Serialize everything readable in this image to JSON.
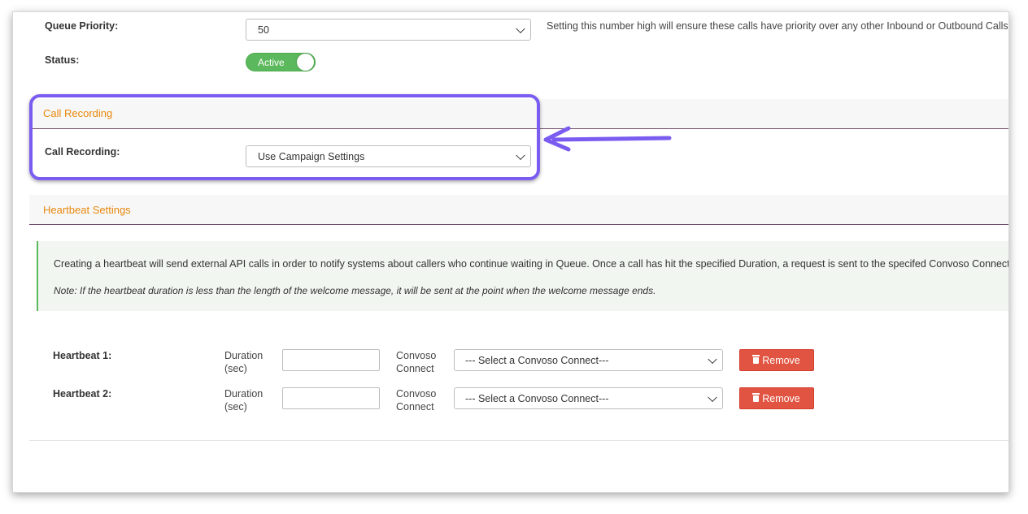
{
  "queue": {
    "priority_label": "Queue Priority:",
    "priority_value": "50",
    "priority_help": "Setting this number high will ensure these calls have priority over any other Inbound or Outbound Calls",
    "status_label": "Status:",
    "status_value": "Active"
  },
  "call_recording": {
    "section_title": "Call Recording",
    "label": "Call Recording:",
    "value": "Use Campaign Settings"
  },
  "heartbeat": {
    "section_title": "Heartbeat Settings",
    "info_text": "Creating a heartbeat will send external API calls in order to notify systems about callers who continue waiting in Queue. Once a call has hit the specified Duration, a request is sent to the specifed Convoso Connect.",
    "note_text": "Note: If the heartbeat duration is less than the length of the welcome message, it will be sent at the point when the welcome message ends.",
    "rows": [
      {
        "label": "Heartbeat 1:",
        "duration_label_1": "Duration",
        "duration_label_2": "(sec)",
        "duration_value": "",
        "connect_label_1": "Convoso",
        "connect_label_2": "Connect",
        "connect_value": "--- Select a Convoso Connect---",
        "remove_label": "Remove"
      },
      {
        "label": "Heartbeat 2:",
        "duration_label_1": "Duration",
        "duration_label_2": "(sec)",
        "duration_value": "",
        "connect_label_1": "Convoso",
        "connect_label_2": "Connect",
        "connect_value": "--- Select a Convoso Connect---",
        "remove_label": "Remove"
      }
    ]
  },
  "colors": {
    "accent_orange": "#e8880c",
    "highlight_purple": "#7b5cf0",
    "active_green": "#5cb85c",
    "remove_red": "#e05441",
    "section_rule": "#6f4b6b"
  }
}
